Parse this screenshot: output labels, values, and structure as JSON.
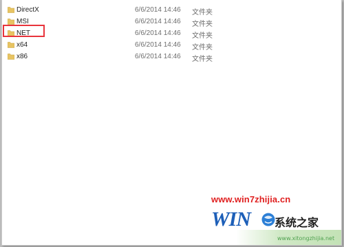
{
  "files": [
    {
      "name": "DirectX",
      "date": "6/6/2014 14:46",
      "type": "文件夹"
    },
    {
      "name": "MSI",
      "date": "6/6/2014 14:46",
      "type": "文件夹"
    },
    {
      "name": "NET",
      "date": "6/6/2014 14:46",
      "type": "文件夹"
    },
    {
      "name": "x64",
      "date": "6/6/2014 14:46",
      "type": "文件夹"
    },
    {
      "name": "x86",
      "date": "6/6/2014 14:46",
      "type": "文件夹"
    }
  ],
  "watermark": {
    "url": "www.win7zhijia.cn",
    "logo_text": "WIN",
    "site_name": "系统之家",
    "sub_url": "www.xitongzhijia.net"
  },
  "icons": {
    "folder": "folder-icon",
    "globe": "globe-icon"
  },
  "colors": {
    "folder": "#e8c463",
    "highlight": "#e8333b",
    "watermark_red": "#e02020",
    "logo_blue": "#1d5fb8"
  }
}
